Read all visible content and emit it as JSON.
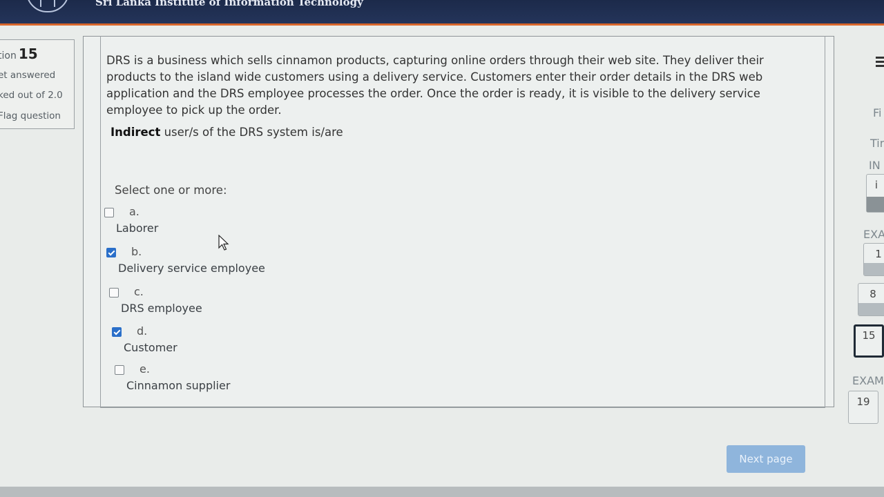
{
  "header": {
    "site_title": "Sri Lanka Institute of Information Technology"
  },
  "question_info": {
    "label": "tion",
    "number": "15",
    "status": "et answered",
    "marks": "ked out of 2.0",
    "flag": "Flag question"
  },
  "question": {
    "text": "DRS is a business which sells cinnamon products, capturing online orders through their web site. They deliver their products to the island wide customers using a delivery service. Customers enter their order details in the DRS web application and the DRS employee processes the order. Once the order is ready, it is visible to the delivery service employee to pick up the order.",
    "prompt_bold": "Indirect",
    "prompt_rest": " user/s of the DRS system is/are",
    "select_label": "Select one or more:",
    "options": [
      {
        "letter": "a.",
        "text": "Laborer",
        "checked": false
      },
      {
        "letter": "b.",
        "text": "Delivery service employee",
        "checked": true
      },
      {
        "letter": "c.",
        "text": "DRS employee",
        "checked": false
      },
      {
        "letter": "d.",
        "text": "Customer",
        "checked": true
      },
      {
        "letter": "e.",
        "text": "Cinnamon supplier",
        "checked": false
      }
    ]
  },
  "footer": {
    "next_label": "Next page"
  },
  "nav_panel": {
    "fi": "Fi",
    "tir": "Tir",
    "ins": "IN",
    "info_btn": "i",
    "exa": "EXA",
    "exam": "EXAM",
    "buttons": [
      "1",
      "8",
      "15",
      "19"
    ]
  }
}
